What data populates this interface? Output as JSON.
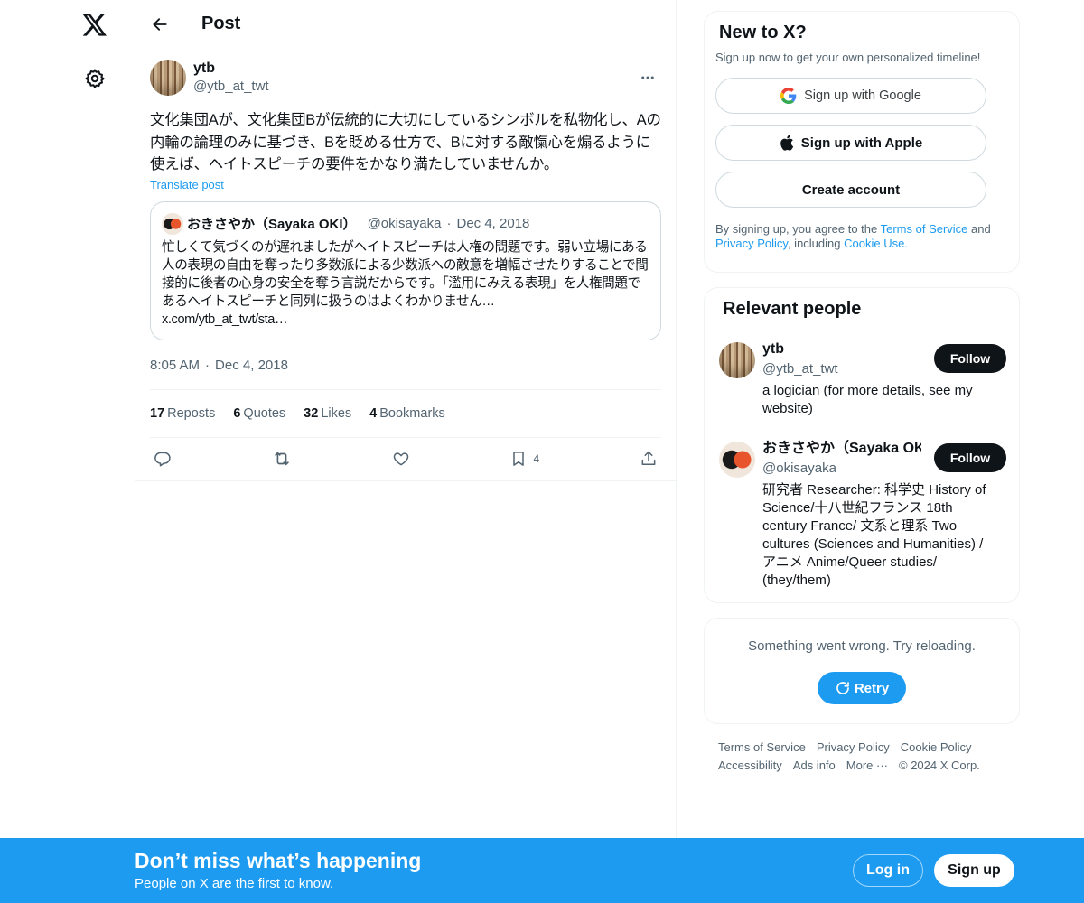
{
  "nav": {
    "logo_icon": "x-logo-icon",
    "settings_icon": "gear-icon"
  },
  "header": {
    "title": "Post"
  },
  "post": {
    "display_name": "ytb",
    "handle": "@ytb_at_twt",
    "text": "文化集団Aが、文化集団Bが伝統的に大切にしているシンボルを私物化し、Aの内輪の論理のみに基づき、Bを貶める仕方で、Bに対する敵愾心を煽るように使えば、ヘイトスピーチの要件をかなり満たしていませんか。",
    "translate_label": "Translate post",
    "time": "8:05 AM",
    "date": "Dec 4, 2018",
    "stats": {
      "reposts_count": "17",
      "reposts_label": "Reposts",
      "quotes_count": "6",
      "quotes_label": "Quotes",
      "likes_count": "32",
      "likes_label": "Likes",
      "bookmarks_count": "4",
      "bookmarks_label": "Bookmarks"
    },
    "bookmark_action_count": "4"
  },
  "quote": {
    "display_name": "おきさやか（Sayaka OKI）",
    "handle": "@okisayaka",
    "date": "Dec 4, 2018",
    "text": "忙しくて気づくのが遅れましたがヘイトスピーチは人権の問題です。弱い立場にある人の表現の自由を奪ったり多数派による少数派への敵意を増幅させたりすることで間接的に後者の心身の安全を奪う言説だからです。「濫用にみえる表現」を人権問題であるヘイトスピーチと同列に扱うのはよくわかりません…",
    "link": "x.com/ytb_at_twt/sta…"
  },
  "signup_card": {
    "title": "New to X?",
    "subtitle": "Sign up now to get your own personalized timeline!",
    "google_label": "Sign up with Google",
    "apple_label": "Sign up with Apple",
    "create_label": "Create account",
    "legal_pre": "By signing up, you agree to the ",
    "terms": "Terms of Service",
    "legal_and": " and ",
    "privacy": "Privacy Policy",
    "legal_including": ", including ",
    "cookie": "Cookie Use."
  },
  "people": {
    "title": "Relevant people",
    "items": [
      {
        "name": "ytb",
        "handle": "@ytb_at_twt",
        "bio": "a logician (for more details, see my website)",
        "follow": "Follow"
      },
      {
        "name": "おきさやか（Sayaka OKI）",
        "handle": "@okisayaka",
        "bio": "研究者 Researcher: 科学史 History of Science/十八世紀フランス 18th century France/ 文系と理系 Two cultures (Sciences and Humanities) / アニメ Anime/Queer studies/ (they/them)",
        "follow": "Follow"
      }
    ]
  },
  "error_card": {
    "text": "Something went wrong. Try reloading.",
    "retry": "Retry"
  },
  "footer": [
    "Terms of Service",
    "Privacy Policy",
    "Cookie Policy",
    "Accessibility",
    "Ads info",
    "More ···",
    "© 2024 X Corp."
  ],
  "bottom_bar": {
    "title": "Don’t miss what’s happening",
    "subtitle": "People on X are the first to know.",
    "login": "Log in",
    "signup": "Sign up"
  },
  "colors": {
    "accent": "#1d9bf0",
    "text": "#0f1419",
    "muted": "#536471",
    "border": "#eff3f4"
  }
}
